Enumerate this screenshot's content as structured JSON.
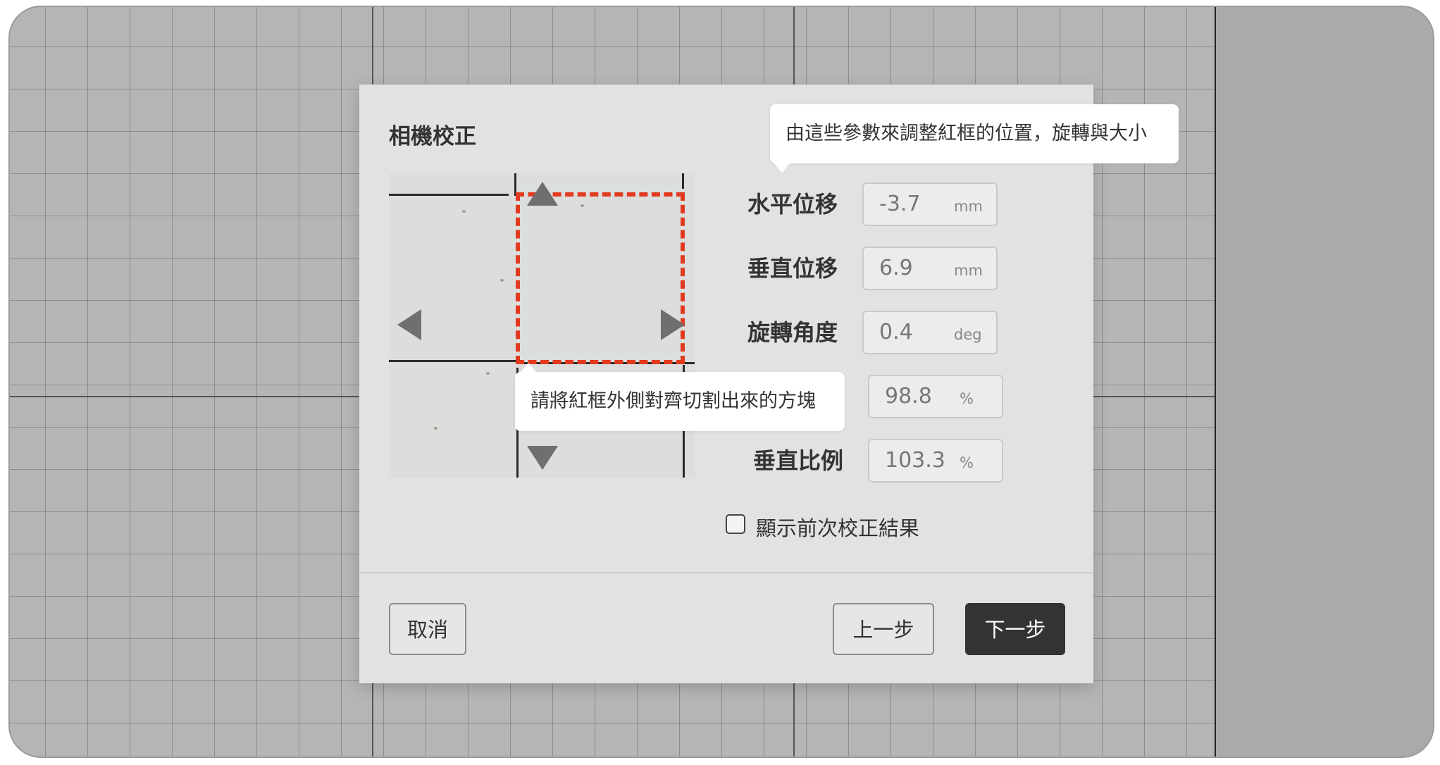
{
  "dialog": {
    "title": "相機校正",
    "tooltip_params": "由這些參數來調整紅框的位置，旋轉與大小",
    "tooltip_preview": "請將紅框外側對齊切割出來的方塊",
    "fields": [
      {
        "label": "水平位移",
        "value": "-3.7",
        "unit": "mm"
      },
      {
        "label": "垂直位移",
        "value": "6.9",
        "unit": "mm"
      },
      {
        "label": "旋轉角度",
        "value": "0.4",
        "unit": "deg"
      },
      {
        "label": "",
        "value": "98.8",
        "unit": "%"
      },
      {
        "label": "垂直比例",
        "value": "103.3",
        "unit": "%"
      }
    ],
    "checkbox_label": "顯示前次校正結果",
    "checkbox_checked": false,
    "buttons": {
      "cancel": "取消",
      "back": "上一步",
      "next": "下一步"
    }
  },
  "colors": {
    "accent_red": "#e23a1f",
    "primary_button": "#333333",
    "dialog_bg": "#e2e2e2",
    "workspace_bg": "#b5b5b5"
  },
  "icons": [
    "arrow-up-icon",
    "arrow-down-icon",
    "arrow-left-icon",
    "arrow-right-icon",
    "checkbox-icon"
  ]
}
